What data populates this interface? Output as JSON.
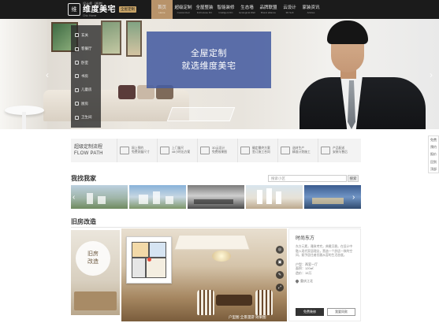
{
  "header": {
    "logo": {
      "mark": "维",
      "top_line": "设计师（香港）",
      "name": "维度美宅",
      "sub_line": "Chic Home",
      "badge": "全屋定制"
    },
    "nav": [
      {
        "label": "首页",
        "sub": "Home",
        "active": true
      },
      {
        "label": "超级定制",
        "sub": "Customized",
        "active": false
      },
      {
        "label": "全屋整装",
        "sub": "Full House DC",
        "active": false
      },
      {
        "label": "智能装修",
        "sub": "Intelligent DC",
        "active": false
      },
      {
        "label": "生态墙",
        "sub": "Ecological Wall",
        "active": false
      },
      {
        "label": "品牌联盟",
        "sub": "Brand alliance",
        "active": false
      },
      {
        "label": "云设计",
        "sub": "3D Soft",
        "active": false
      },
      {
        "label": "家装资讯",
        "sub": "Articles",
        "active": false
      }
    ]
  },
  "banner": {
    "slogan_1": "全屋定制",
    "slogan_2": "就选维度美宅",
    "side_menu": [
      "玄关",
      "客餐厅",
      "卧室",
      "书房",
      "儿童房",
      "厨房",
      "卫生间"
    ],
    "arrow_left": "‹",
    "arrow_right": "›",
    "slides": 4,
    "active_slide": 1
  },
  "float_bar": [
    "免费",
    "预约",
    "报价",
    "回到",
    "顶部"
  ],
  "process": {
    "title_cn": "超级定制流程",
    "title_en": "FLOW PATH",
    "steps": [
      {
        "icon": "computer-icon",
        "line1": "网上预约",
        "line2": "免费测量尺寸"
      },
      {
        "icon": "house-icon",
        "line1": "上门量尺",
        "line2": "48小时出方案"
      },
      {
        "icon": "cube-icon",
        "line1": "3D云设计",
        "line2": "免费效果图"
      },
      {
        "icon": "document-icon",
        "line1": "确定最终方案",
        "line2": "签订施工合同"
      },
      {
        "icon": "truck-icon",
        "line1": "选材生产",
        "line2": "精准计划施工"
      },
      {
        "icon": "box-icon",
        "line1": "产品配送",
        "line2": "安装与售后"
      }
    ]
  },
  "find_home": {
    "title": "我找我家",
    "search_placeholder": "搜索小区",
    "search_button": "搜索",
    "arrow_left": "‹",
    "arrow_right": "›"
  },
  "renovation": {
    "title": "旧房改造",
    "old_label_1": "旧房",
    "old_label_2": "改造",
    "tools": [
      "◎",
      "▣",
      "✎",
      "⤢"
    ],
    "caption": "户型图 全景漫游 效果图",
    "card": {
      "title": "时尚东方",
      "desc": "东方元素，雅致考究，典雅沉稳。在设计中融入现代家居理念，营造一个舒适一致的空间，赋予居住者优雅从容的生活态度。",
      "style": "户型：两室一厅",
      "area": "面积：120㎡",
      "budget": "造价：15万",
      "location": "重庆江北",
      "btn_primary": "免费装修",
      "btn_secondary": "我要同款"
    }
  },
  "colors": {
    "header_bg": "#1b1b1b",
    "accent_gold": "#b8936a",
    "slogan_blue": "#465ca0"
  }
}
